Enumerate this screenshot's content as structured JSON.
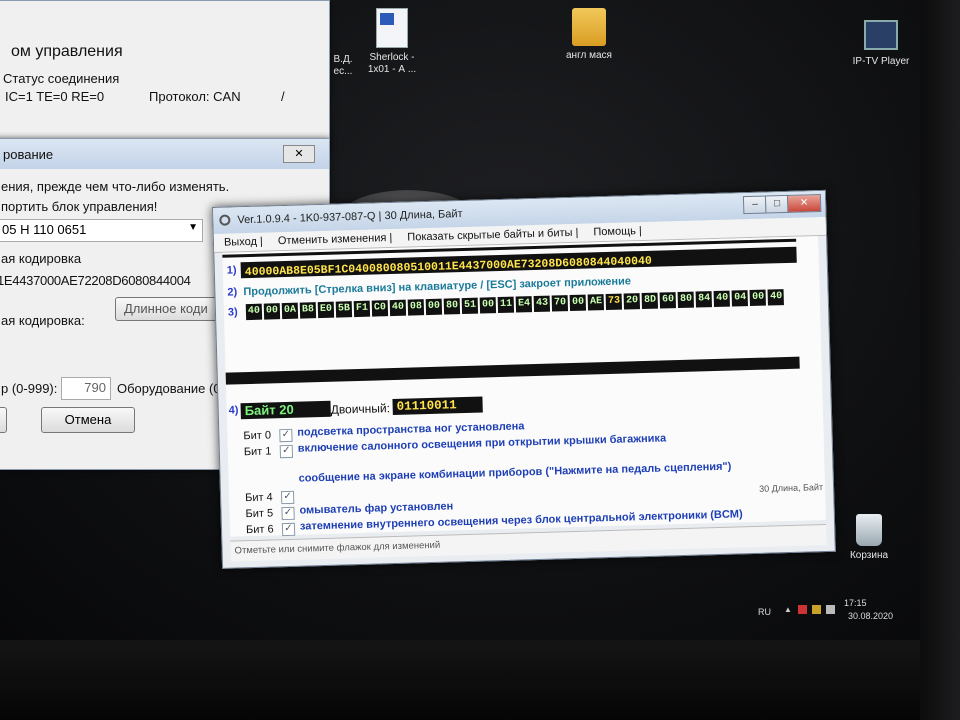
{
  "desktop": {
    "icons": [
      {
        "label": "В.Д.\nес..."
      },
      {
        "label": "Sherlock -\n1x01 - А ..."
      },
      {
        "label": "англ мася"
      },
      {
        "label": "IP-TV Player"
      },
      {
        "label": "Корзина"
      }
    ]
  },
  "bg_window_1": {
    "title_fragment": "ом управления",
    "status_heading": "Статус соединения",
    "status_line": "IC=1 TE=0  RE=0",
    "protocol": "Протокол: CAN",
    "slash": "/"
  },
  "bg_window_2": {
    "title_fragment": "рование",
    "close_label": "✕",
    "warning_line_1": "ения, прежде чем что-либо изменять.",
    "warning_line_2": "портить блок управления!",
    "part_select_value": "05  H   110 0651",
    "coding_label": "ая кодировка",
    "coding_value": "1E4437000AE72208D6080844004",
    "new_coding_label": "ая кодировка:",
    "long_coding_button": "Длинное коди",
    "range_label": "р (0-999):",
    "range_value": "790",
    "equipment_label": "Оборудование (0",
    "cancel_button": "Отмена"
  },
  "app": {
    "title": "Ver.1.0.9.4 -   1K0-937-087-Q | 30 Длина, Байт",
    "window_buttons": {
      "minimize": "–",
      "maximize": "□",
      "close": "✕"
    },
    "menu": [
      "Выход |",
      "Отменить изменения |",
      "Показать скрытые байты и биты |",
      "Помощь |"
    ],
    "row1": {
      "num": "1)",
      "hex": "40000AB8E05BF1C040080080510011E4437000AE73208D6080844040040"
    },
    "row2": {
      "num": "2)",
      "text": "Продолжить [Стрелка вниз] на клавиатуре / [ESC] закроет приложение"
    },
    "row3": {
      "num": "3)",
      "bytes": [
        "40",
        "00",
        "0A",
        "B8",
        "E0",
        "5B",
        "F1",
        "C0",
        "40",
        "08",
        "00",
        "80",
        "51",
        "00",
        "11",
        "E4",
        "43",
        "70",
        "00",
        "AE",
        "73",
        "20",
        "8D",
        "60",
        "80",
        "84",
        "40",
        "04",
        "00",
        "40"
      ],
      "highlight_index": 20
    },
    "row4": {
      "num": "4)",
      "byte_label": "Байт 20",
      "binary_label": "Двоичный:",
      "binary_value": "01110011"
    },
    "bits": [
      {
        "label": "Бит 0",
        "checked": true,
        "desc": "подсветка пространства ног установлена"
      },
      {
        "label": "Бит 1",
        "checked": true,
        "desc": "включение салонного освещения при открытии крышки багажника"
      },
      {
        "label": "",
        "checked": false,
        "desc": "сообщение на экране комбинации приборов (\"Нажмите на педаль сцепления\")"
      },
      {
        "label": "Бит 4",
        "checked": true,
        "desc": ""
      },
      {
        "label": "Бит 5",
        "checked": true,
        "desc": "омыватель фар установлен"
      },
      {
        "label": "Бит 6",
        "checked": true,
        "desc": "затемнение внутреннего освещения через блок центральной электроники (BCM)"
      }
    ],
    "size_badge": "30 Длина, Байт",
    "status_bar": "Отметьте или снимите флажок для изменений"
  },
  "tray": {
    "lang": "RU",
    "time": "17:15",
    "date": "30.08.2020"
  }
}
